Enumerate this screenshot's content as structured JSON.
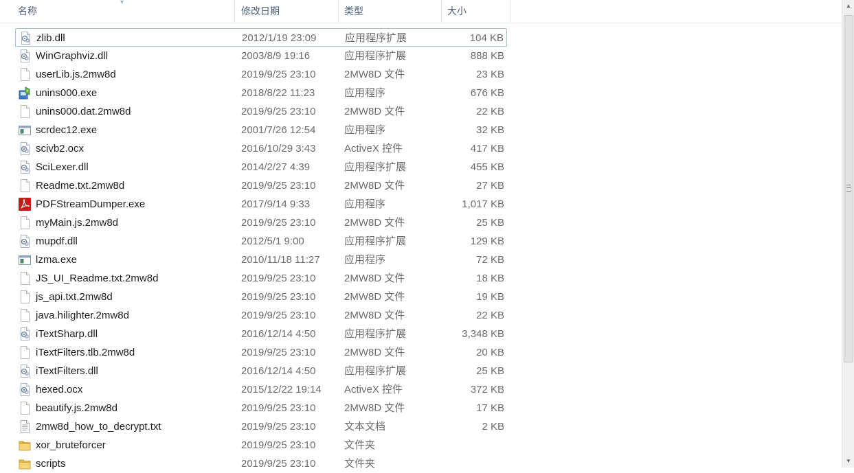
{
  "header": {
    "name": "名称",
    "date": "修改日期",
    "type": "类型",
    "size": "大小"
  },
  "files": [
    {
      "name": "zlib.dll",
      "date": "2012/1/19 23:09",
      "type": "应用程序扩展",
      "size": "104 KB",
      "icon": "dll-icon"
    },
    {
      "name": "WinGraphviz.dll",
      "date": "2003/8/9 19:16",
      "type": "应用程序扩展",
      "size": "888 KB",
      "icon": "dll-icon"
    },
    {
      "name": "userLib.js.2mw8d",
      "date": "2019/9/25 23:10",
      "type": "2MW8D 文件",
      "size": "23 KB",
      "icon": "file-icon"
    },
    {
      "name": "unins000.exe",
      "date": "2018/8/22 11:23",
      "type": "应用程序",
      "size": "676 KB",
      "icon": "installer-icon"
    },
    {
      "name": "unins000.dat.2mw8d",
      "date": "2019/9/25 23:10",
      "type": "2MW8D 文件",
      "size": "22 KB",
      "icon": "file-icon"
    },
    {
      "name": "scrdec12.exe",
      "date": "2001/7/26 12:54",
      "type": "应用程序",
      "size": "32 KB",
      "icon": "exe-icon"
    },
    {
      "name": "scivb2.ocx",
      "date": "2016/10/29 3:43",
      "type": "ActiveX 控件",
      "size": "417 KB",
      "icon": "dll-icon"
    },
    {
      "name": "SciLexer.dll",
      "date": "2014/2/27 4:39",
      "type": "应用程序扩展",
      "size": "455 KB",
      "icon": "dll-icon"
    },
    {
      "name": "Readme.txt.2mw8d",
      "date": "2019/9/25 23:10",
      "type": "2MW8D 文件",
      "size": "27 KB",
      "icon": "file-icon"
    },
    {
      "name": "PDFStreamDumper.exe",
      "date": "2017/9/14 9:33",
      "type": "应用程序",
      "size": "1,017 KB",
      "icon": "pdf-icon"
    },
    {
      "name": "myMain.js.2mw8d",
      "date": "2019/9/25 23:10",
      "type": "2MW8D 文件",
      "size": "25 KB",
      "icon": "file-icon"
    },
    {
      "name": "mupdf.dll",
      "date": "2012/5/1 9:00",
      "type": "应用程序扩展",
      "size": "129 KB",
      "icon": "dll-icon"
    },
    {
      "name": "lzma.exe",
      "date": "2010/11/18 11:27",
      "type": "应用程序",
      "size": "72 KB",
      "icon": "exe-icon"
    },
    {
      "name": "JS_UI_Readme.txt.2mw8d",
      "date": "2019/9/25 23:10",
      "type": "2MW8D 文件",
      "size": "18 KB",
      "icon": "file-icon"
    },
    {
      "name": "js_api.txt.2mw8d",
      "date": "2019/9/25 23:10",
      "type": "2MW8D 文件",
      "size": "19 KB",
      "icon": "file-icon"
    },
    {
      "name": "java.hilighter.2mw8d",
      "date": "2019/9/25 23:10",
      "type": "2MW8D 文件",
      "size": "22 KB",
      "icon": "file-icon"
    },
    {
      "name": "iTextSharp.dll",
      "date": "2016/12/14 4:50",
      "type": "应用程序扩展",
      "size": "3,348 KB",
      "icon": "dll-icon"
    },
    {
      "name": "iTextFilters.tlb.2mw8d",
      "date": "2019/9/25 23:10",
      "type": "2MW8D 文件",
      "size": "20 KB",
      "icon": "file-icon"
    },
    {
      "name": "iTextFilters.dll",
      "date": "2016/12/14 4:50",
      "type": "应用程序扩展",
      "size": "25 KB",
      "icon": "dll-icon"
    },
    {
      "name": "hexed.ocx",
      "date": "2015/12/22 19:14",
      "type": "ActiveX 控件",
      "size": "372 KB",
      "icon": "dll-icon"
    },
    {
      "name": "beautify.js.2mw8d",
      "date": "2019/9/25 23:10",
      "type": "2MW8D 文件",
      "size": "17 KB",
      "icon": "file-icon"
    },
    {
      "name": "2mw8d_how_to_decrypt.txt",
      "date": "2019/9/25 23:10",
      "type": "文本文档",
      "size": "2 KB",
      "icon": "text-file-icon"
    },
    {
      "name": "xor_bruteforcer",
      "date": "2019/9/25 23:10",
      "type": "文件夹",
      "size": "",
      "icon": "folder-icon"
    },
    {
      "name": "scripts",
      "date": "2019/9/25 23:10",
      "type": "文件夹",
      "size": "",
      "icon": "folder-icon"
    }
  ],
  "colors": {
    "header_text": "#4c607a",
    "focus_border": "#9fc1e6",
    "secondary_text": "#6d6d6d"
  }
}
